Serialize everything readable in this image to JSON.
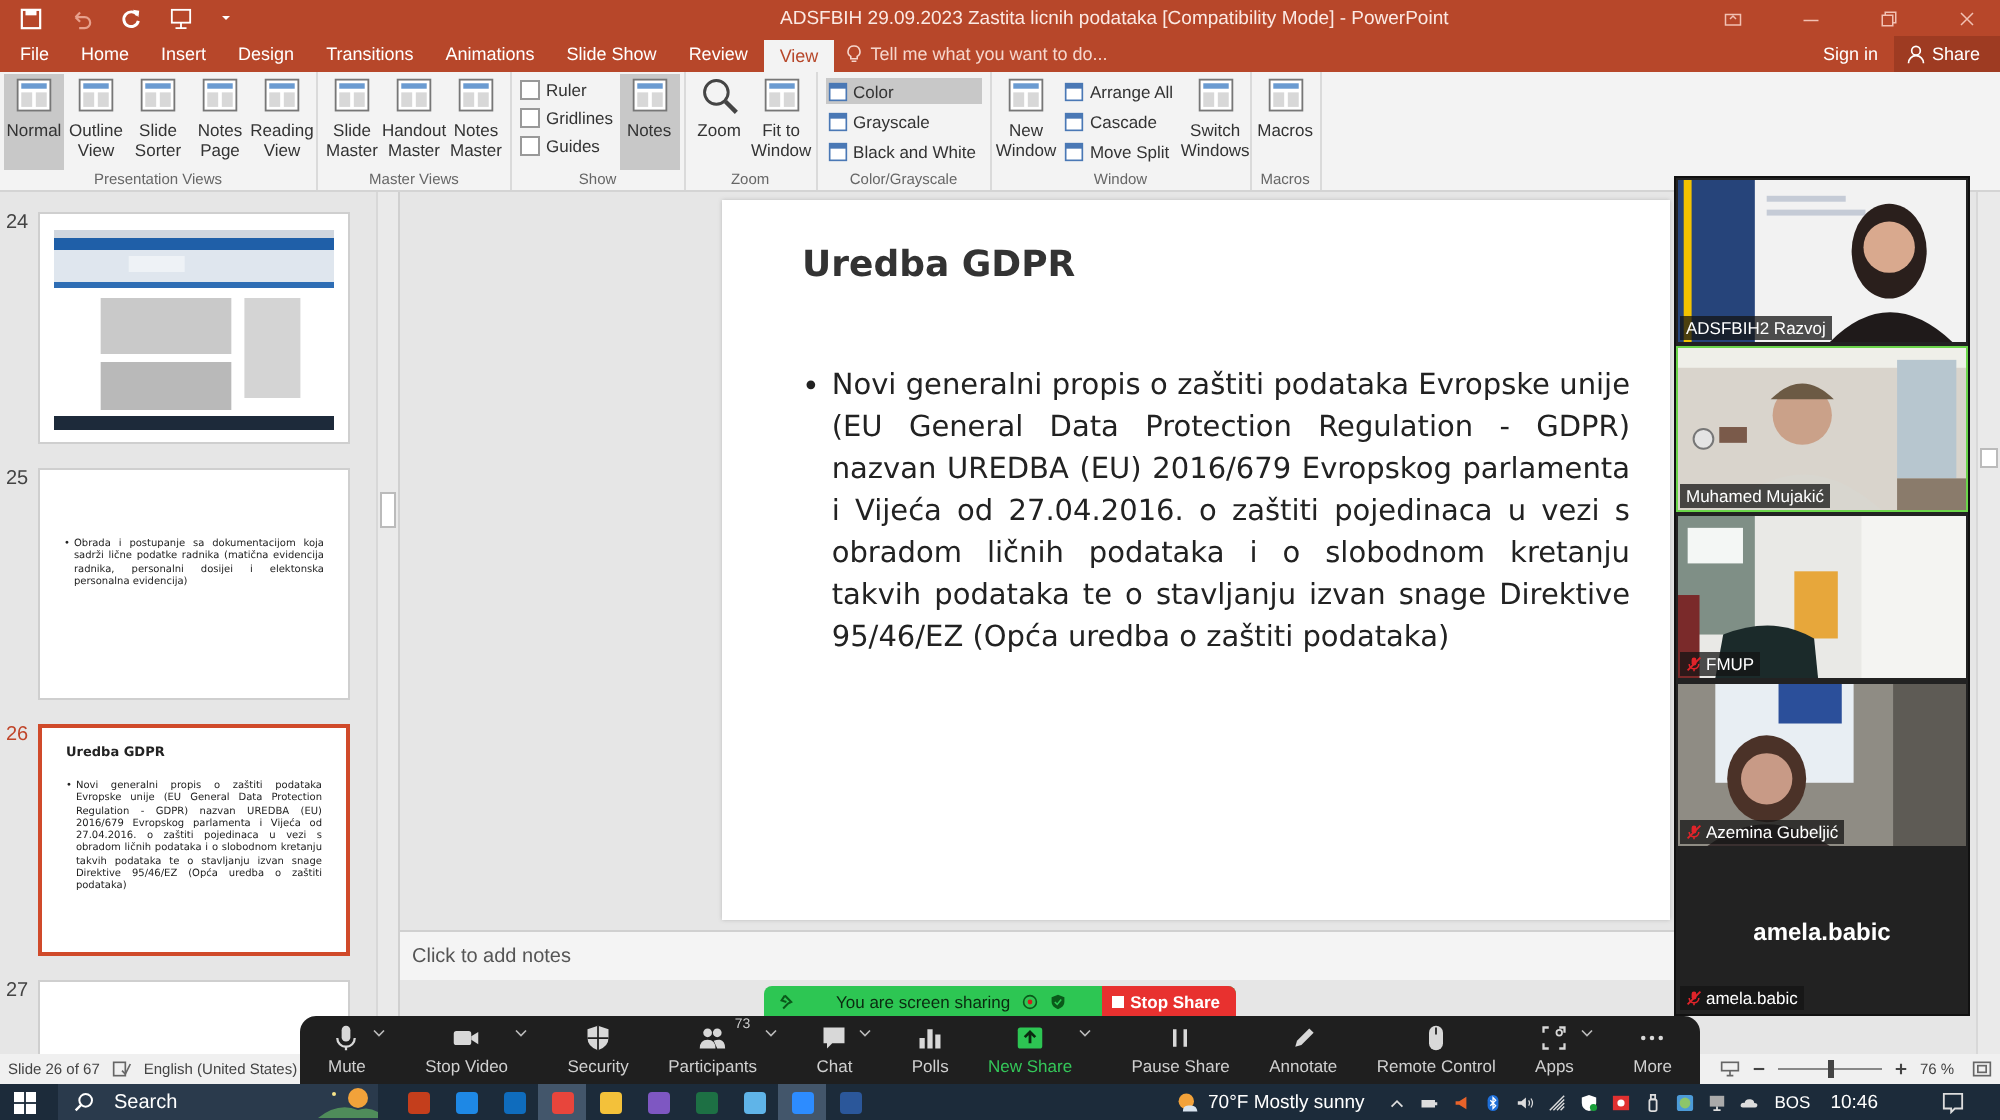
{
  "title_bar": {
    "title": "ADSFBIH 29.09.2023 Zastita licnih podataka [Compatibility Mode] - PowerPoint"
  },
  "tabs": [
    {
      "label": "File",
      "selected": false
    },
    {
      "label": "Home",
      "selected": false
    },
    {
      "label": "Insert",
      "selected": false
    },
    {
      "label": "Design",
      "selected": false
    },
    {
      "label": "Transitions",
      "selected": false
    },
    {
      "label": "Animations",
      "selected": false
    },
    {
      "label": "Slide Show",
      "selected": false
    },
    {
      "label": "Review",
      "selected": false
    },
    {
      "label": "View",
      "selected": true
    }
  ],
  "tell_me": {
    "placeholder": "Tell me what you want to do..."
  },
  "account": {
    "sign_in": "Sign in",
    "share": "Share"
  },
  "ribbon": {
    "groups": [
      {
        "label": "Presentation Views",
        "items": [
          {
            "kind": "large",
            "label": "Normal",
            "selected": true
          },
          {
            "kind": "large",
            "label": "Outline View",
            "selected": false
          },
          {
            "kind": "large",
            "label": "Slide Sorter",
            "selected": false
          },
          {
            "kind": "large",
            "label": "Notes Page",
            "selected": false
          },
          {
            "kind": "large",
            "label": "Reading View",
            "selected": false
          }
        ]
      },
      {
        "label": "Master Views",
        "items": [
          {
            "kind": "large",
            "label": "Slide Master",
            "selected": false
          },
          {
            "kind": "large",
            "label": "Handout Master",
            "selected": false
          },
          {
            "kind": "large",
            "label": "Notes Master",
            "selected": false
          }
        ]
      },
      {
        "label": "Show",
        "items": [
          {
            "kind": "check",
            "label": "Ruler",
            "checked": false
          },
          {
            "kind": "check",
            "label": "Gridlines",
            "checked": false
          },
          {
            "kind": "check",
            "label": "Guides",
            "checked": false
          },
          {
            "kind": "large",
            "label": "Notes",
            "selected": true
          }
        ]
      },
      {
        "label": "Zoom",
        "items": [
          {
            "kind": "lens",
            "label": "Zoom",
            "selected": false
          },
          {
            "kind": "large",
            "label": "Fit to Window",
            "selected": false
          }
        ]
      },
      {
        "label": "Color/Grayscale",
        "items": [
          {
            "kind": "small",
            "label": "Color",
            "selected": true
          },
          {
            "kind": "small",
            "label": "Grayscale",
            "selected": false
          },
          {
            "kind": "small",
            "label": "Black and White",
            "selected": false
          }
        ]
      },
      {
        "label": "Window",
        "items": [
          {
            "kind": "large",
            "label": "New Window",
            "selected": false
          },
          {
            "kind": "small",
            "label": "Arrange All",
            "selected": false
          },
          {
            "kind": "small",
            "label": "Cascade",
            "selected": false
          },
          {
            "kind": "small",
            "label": "Move Split",
            "selected": false
          },
          {
            "kind": "large",
            "label": "Switch Windows",
            "selected": false
          }
        ]
      },
      {
        "label": "Macros",
        "items": [
          {
            "kind": "large",
            "label": "Macros",
            "selected": false
          }
        ]
      }
    ]
  },
  "slides": [
    {
      "number": "24",
      "kind": "screenshot",
      "selected": false
    },
    {
      "number": "25",
      "kind": "text",
      "selected": false,
      "marker": "•",
      "bullet": "Obrada i postupanje sa dokumentacijom koja sadrži lične podatke radnika (matična evidencija radnika, personalni dosijei i elektonska personalna evidencija)"
    },
    {
      "number": "26",
      "kind": "text",
      "selected": true,
      "title": "Uredba GDPR",
      "marker": "•",
      "bullet": "Novi generalni propis o zaštiti podataka Evropske unije (EU General Data Protection Regulation - GDPR) nazvan UREDBA (EU) 2016/679 Evropskog parlamenta i Vijeća od 27.04.2016. o zaštiti pojedinaca u vezi s obradom ličnih podataka i o slobodnom kretanju takvih podataka te o stavljanju izvan snage Direktive 95/46/EZ (Opća uredba o zaštiti podataka)"
    },
    {
      "number": "27",
      "kind": "blank",
      "selected": false
    }
  ],
  "current_slide": {
    "title": "Uredba GDPR",
    "bullets": [
      {
        "marker": "•",
        "text": "Novi generalni propis o zaštiti podataka Evropske unije (EU General Data Protection Regulation - GDPR) nazvan UREDBA (EU) 2016/679 Evropskog parlamenta i Vijeća od 27.04.2016. o zaštiti pojedinaca u vezi s obradom ličnih podataka i o slobodnom kretanju takvih podataka te o stavljanju izvan snage Direktive 95/46/EZ (Opća uredba o zaštiti podataka)"
      }
    ]
  },
  "notes": {
    "placeholder": "Click to add notes"
  },
  "participants": [
    {
      "kind": "video",
      "name": "ADSFBIH2 Razvoj",
      "muted": false,
      "speaking": false
    },
    {
      "kind": "video",
      "name": "Muhamed Mujakić",
      "muted": false,
      "speaking": true
    },
    {
      "kind": "video",
      "name": "FMUP",
      "muted": true,
      "speaking": false
    },
    {
      "kind": "video",
      "name": "Azemina Gubeljić",
      "muted": true,
      "speaking": false
    },
    {
      "kind": "avatar",
      "display_name": "amela.babic",
      "name": "amela.babic",
      "muted": true,
      "speaking": false
    }
  ],
  "share_banner": {
    "message": "You are screen sharing",
    "stop": "Stop Share"
  },
  "meeting_toolbar": [
    {
      "kind": "mic",
      "label": "Mute",
      "caret": true
    },
    {
      "kind": "camera",
      "label": "Stop Video",
      "caret": true
    },
    {
      "kind": "shield",
      "label": "Security",
      "caret": false
    },
    {
      "kind": "people",
      "label": "Participants",
      "caret": true,
      "badge": "73"
    },
    {
      "kind": "chat",
      "label": "Chat",
      "caret": true
    },
    {
      "kind": "polls",
      "label": "Polls",
      "caret": false
    },
    {
      "kind": "share",
      "label": "New Share",
      "caret": true
    },
    {
      "kind": "pause",
      "label": "Pause Share",
      "caret": false
    },
    {
      "kind": "pencil",
      "label": "Annotate",
      "caret": false
    },
    {
      "kind": "mouse",
      "label": "Remote Control",
      "caret": false
    },
    {
      "kind": "apps",
      "label": "Apps",
      "caret": true
    },
    {
      "kind": "more",
      "label": "More",
      "caret": false
    }
  ],
  "status_bar": {
    "slide_info": "Slide 26 of 67",
    "language": "English (United States)",
    "zoom_percent": "76 %",
    "zoom": {
      "level": 0.5
    }
  },
  "taskbar": {
    "search": {
      "placeholder": "Search"
    },
    "apps": [
      {
        "kind": "powerpoint",
        "active": false
      },
      {
        "kind": "edge",
        "active": false
      },
      {
        "kind": "outlook",
        "active": false
      },
      {
        "kind": "chrome",
        "active": true
      },
      {
        "kind": "explorer",
        "active": false
      },
      {
        "kind": "store",
        "active": false
      },
      {
        "kind": "excel",
        "active": false
      },
      {
        "kind": "photos",
        "active": false
      },
      {
        "kind": "zoom",
        "active": true
      },
      {
        "kind": "word",
        "active": false
      }
    ],
    "weather": "70°F Mostly sunny",
    "language": "BOS",
    "time": "10:46"
  }
}
